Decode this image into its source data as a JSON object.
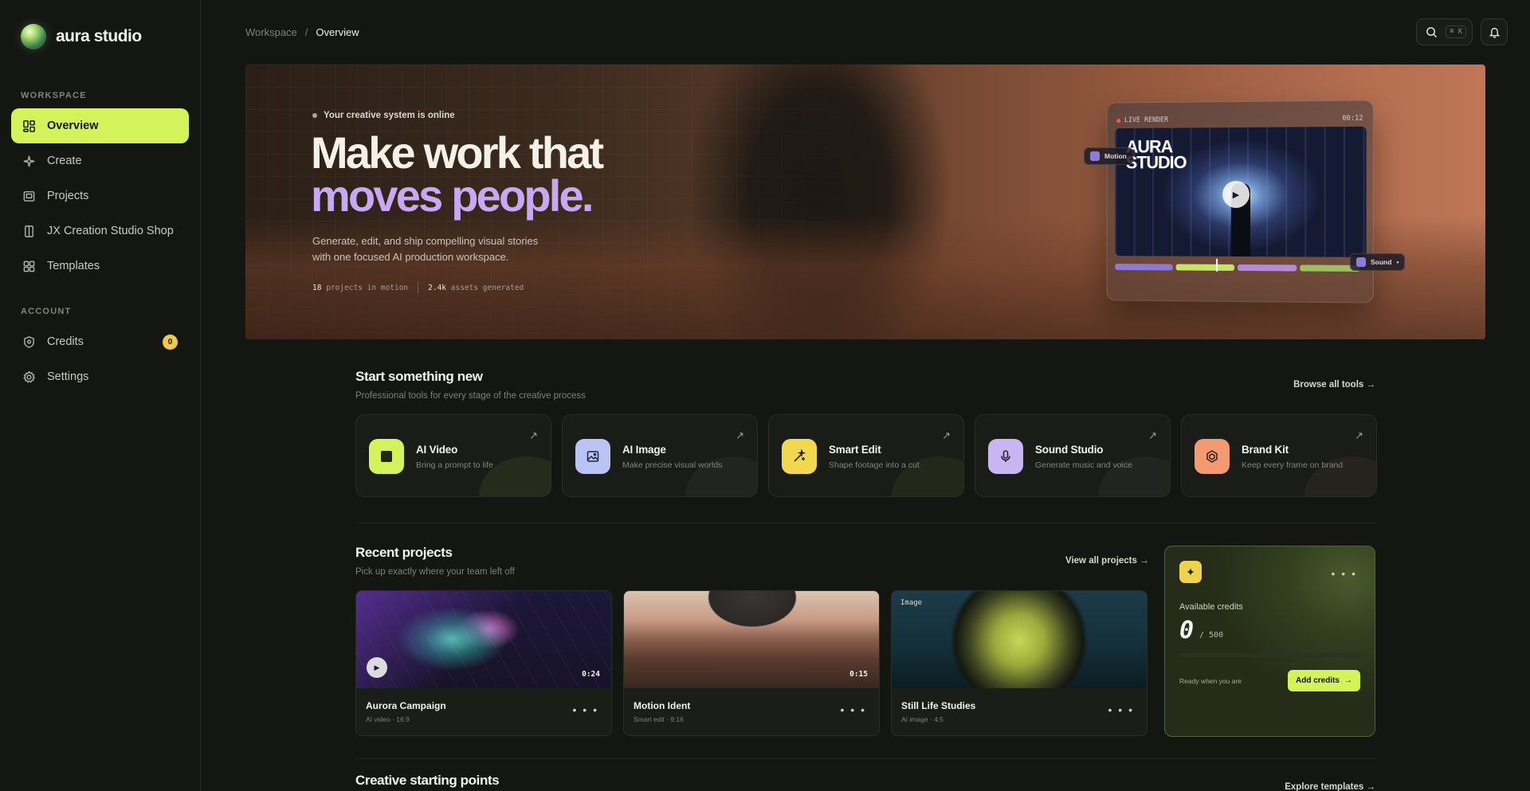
{
  "brand": {
    "name": "aura studio"
  },
  "sidebar": {
    "workspace_heading": "WORKSPACE",
    "account_heading": "ACCOUNT",
    "items": [
      {
        "label": "Overview",
        "icon": "grid-icon",
        "active": true
      },
      {
        "label": "Create",
        "icon": "sparkle-icon"
      },
      {
        "label": "Projects",
        "icon": "folder-icon"
      },
      {
        "label": "JX Creation Studio Shop",
        "icon": "shop-icon"
      },
      {
        "label": "Templates",
        "icon": "templates-icon"
      }
    ],
    "account_items": [
      {
        "label": "Credits",
        "icon": "shield-icon",
        "badge": "0"
      },
      {
        "label": "Settings",
        "icon": "gear-icon"
      }
    ]
  },
  "header": {
    "breadcrumb_root": "Workspace",
    "breadcrumb_sep": "/",
    "breadcrumb_current": "Overview",
    "search_shortcut": "⌘ K"
  },
  "hero": {
    "status": "Your creative system is online",
    "title_line1": "Make work that",
    "title_line2": "moves people.",
    "description": "Generate, edit, and ship compelling visual stories with one focused AI production workspace.",
    "stat1_value": "18",
    "stat1_label": "projects in motion",
    "stat2_value": "2.4k",
    "stat2_label": "assets generated",
    "render_label": "LIVE RENDER",
    "render_time": "00:12",
    "render_brand_line1": "AURA",
    "render_brand_line2": "STUDIO",
    "chip_motion": "Motion",
    "chip_sound": "Sound"
  },
  "start": {
    "title": "Start something new",
    "subtitle": "Professional tools for every stage of the creative process",
    "link": "Browse all tools →",
    "tools": [
      {
        "title": "AI Video",
        "subtitle": "Bring a prompt to life",
        "color": "#d4f25a",
        "icon": "video-icon"
      },
      {
        "title": "AI Image",
        "subtitle": "Make precise visual worlds",
        "color": "#b9c4f5",
        "icon": "image-icon"
      },
      {
        "title": "Smart Edit",
        "subtitle": "Shape footage into a cut",
        "color": "#f2d84c",
        "icon": "wand-icon"
      },
      {
        "title": "Sound Studio",
        "subtitle": "Generate music and voice",
        "color": "#c9b5f2",
        "icon": "mic-icon"
      },
      {
        "title": "Brand Kit",
        "subtitle": "Keep every frame on brand",
        "color": "#f39a72",
        "icon": "cube-icon"
      }
    ]
  },
  "recent": {
    "title": "Recent projects",
    "subtitle": "Pick up exactly where your team left off",
    "link": "View all projects →",
    "projects": [
      {
        "title": "Aurora Campaign",
        "meta": "AI video · 16:9",
        "duration": "0:24"
      },
      {
        "title": "Motion Ident",
        "meta": "Smart edit · 9:16",
        "duration": "0:15"
      },
      {
        "title": "Still Life Studies",
        "meta": "AI image · 4:5",
        "tag": "Image"
      }
    ]
  },
  "credits": {
    "label": "Available credits",
    "value": "0",
    "max": "/ 500",
    "ready": "Ready when you are",
    "button": "Add credits",
    "button_arrow": "→",
    "fill_fraction": 0
  },
  "starting": {
    "title": "Creative starting points",
    "link": "Explore templates →"
  }
}
